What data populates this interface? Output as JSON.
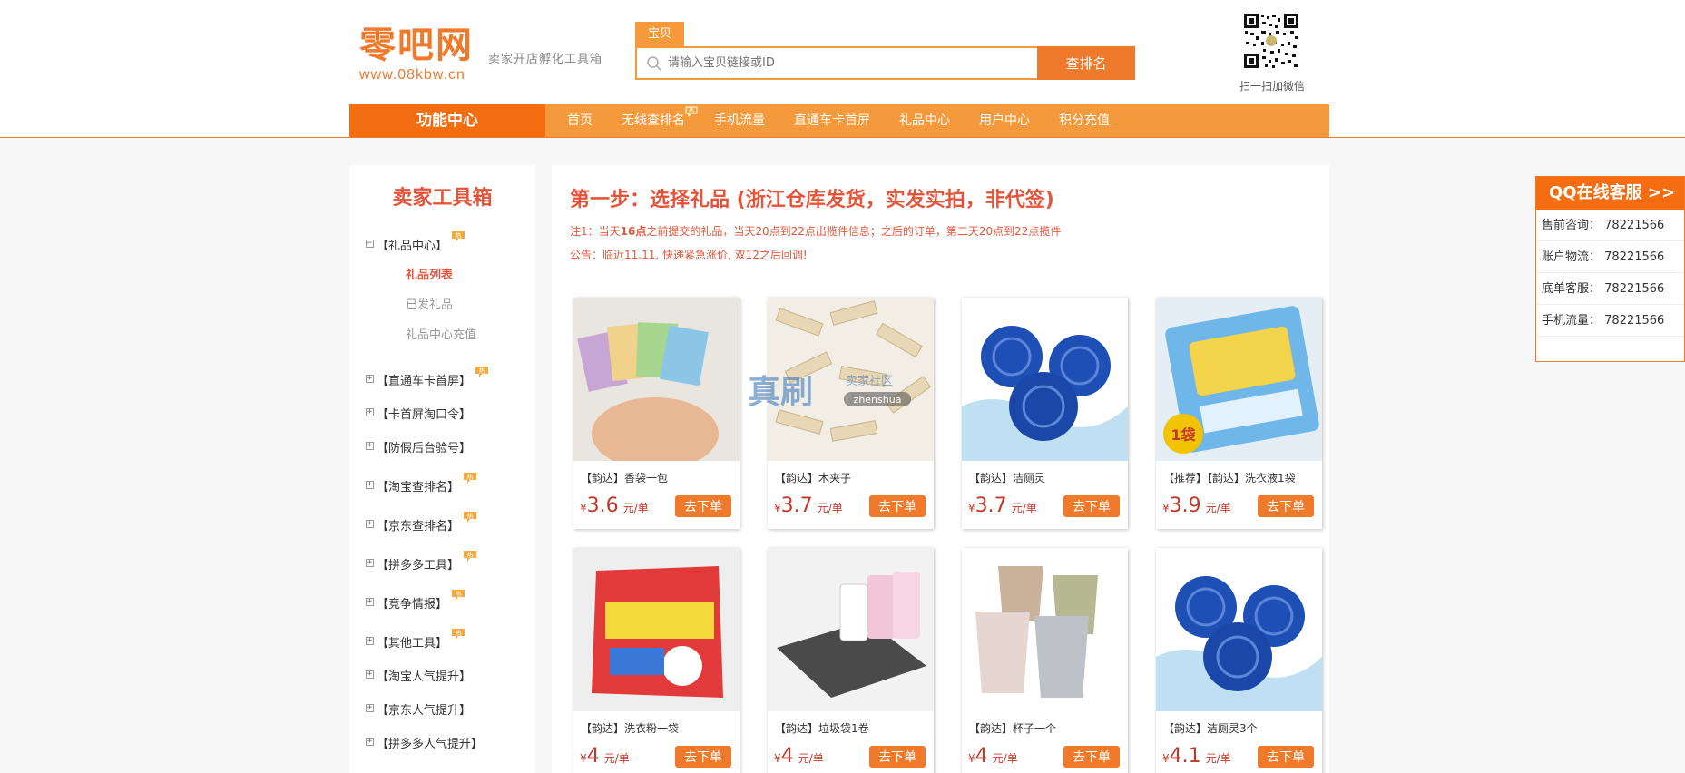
{
  "header": {
    "logo_main": "零吧网",
    "logo_url": "www.08kbw.cn",
    "slogan": "卖家开店孵化工具箱",
    "search_tab": "宝贝",
    "search_placeholder": "请输入宝贝链接或ID",
    "search_button": "查排名",
    "qr_caption": "扫一扫加微信"
  },
  "nav": {
    "func_center": "功能中心",
    "items": [
      "首页",
      "无线查排名",
      "手机流量",
      "直通车卡首屏",
      "礼品中心",
      "用户中心",
      "积分充值"
    ]
  },
  "sidebar": {
    "title": "卖家工具箱",
    "gift_center": "【礼品中心】",
    "sub_items": [
      "礼品列表",
      "已发礼品",
      "礼品中心充值"
    ],
    "menu": [
      "【直通车卡首屏】",
      "【卡首屏淘口令】",
      "【防假后台验号】",
      "【淘宝查排名】",
      "【京东查排名】",
      "【拼多多工具】",
      "【竞争情报】",
      "【其他工具】",
      "【淘宝人气提升】",
      "【京东人气提升】",
      "【拼多多人气提升】"
    ],
    "toggle_collapsed": "+",
    "toggle_expanded": "−"
  },
  "main": {
    "step_title": "第一步：选择礼品 (浙江仓库发货，实发实拍，非代签)",
    "note_prefix": "注1：当天",
    "note_bold": "16点",
    "note_suffix": "之前提交的礼品，当天20点到22点出揽件信息；之后的订单，第二天20点到22点揽件",
    "notice": "公告：临近11.11, 快递紧急涨价, 双12之后回调!",
    "currency": "¥",
    "unit": "元/单",
    "order_label": "去下单",
    "products": [
      {
        "name": "【韵达】香袋一包",
        "price": "3.6"
      },
      {
        "name": "【韵达】木夹子",
        "price": "3.7"
      },
      {
        "name": "【韵达】洁厕灵",
        "price": "3.7"
      },
      {
        "name": "【推荐】【韵达】洗衣液1袋",
        "price": "3.9",
        "badge": "1袋"
      },
      {
        "name": "【韵达】洗衣粉一袋",
        "price": "4"
      },
      {
        "name": "【韵达】垃圾袋1卷",
        "price": "4"
      },
      {
        "name": "【韵达】杯子一个",
        "price": "4"
      },
      {
        "name": "【韵达】洁厕灵3个",
        "price": "4.1"
      }
    ]
  },
  "watermark": {
    "main": "真刷",
    "sub": "zhenshua",
    "tag": "卖家社区"
  },
  "qq": {
    "title": "QQ在线客服 >>",
    "rows": [
      {
        "label": "售前咨询：",
        "number": "78221566"
      },
      {
        "label": "账户物流：",
        "number": "78221566"
      },
      {
        "label": "底单客服：",
        "number": "78221566"
      },
      {
        "label": "手机流量：",
        "number": "78221566"
      }
    ]
  },
  "colors": {
    "brand_orange": "#f07a2c",
    "nav_orange": "#f59a3c",
    "title_red": "#e5553b"
  },
  "icons": [
    "search-icon",
    "qr-code-icon",
    "hot-badge-icon",
    "tree-toggle-icon"
  ]
}
